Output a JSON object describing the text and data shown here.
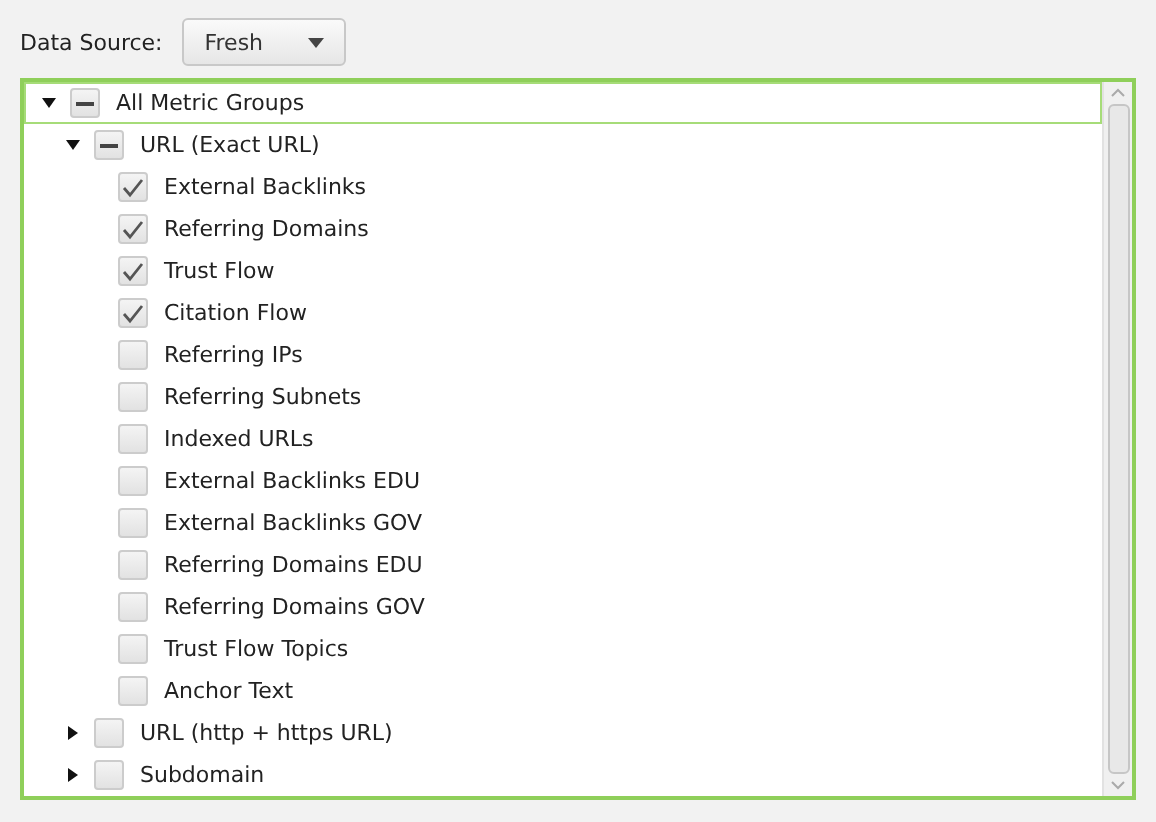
{
  "data_source": {
    "label": "Data Source:",
    "value": "Fresh"
  },
  "tree": [
    {
      "label": "All Metric Groups",
      "partial": true,
      "expanded": true,
      "selected": true,
      "children": [
        {
          "label": "URL (Exact URL)",
          "partial": true,
          "expanded": true,
          "selected": false,
          "children": [
            {
              "label": "External Backlinks",
              "checked": true,
              "partial": false,
              "selected": false
            },
            {
              "label": "Referring Domains",
              "checked": true,
              "partial": false,
              "selected": false
            },
            {
              "label": "Trust Flow",
              "checked": true,
              "partial": false,
              "selected": false
            },
            {
              "label": "Citation Flow",
              "checked": true,
              "partial": false,
              "selected": false
            },
            {
              "label": "Referring IPs",
              "checked": false,
              "partial": false,
              "selected": false
            },
            {
              "label": "Referring Subnets",
              "checked": false,
              "partial": false,
              "selected": false
            },
            {
              "label": "Indexed URLs",
              "checked": false,
              "partial": false,
              "selected": false
            },
            {
              "label": "External Backlinks EDU",
              "checked": false,
              "partial": false,
              "selected": false
            },
            {
              "label": "External Backlinks GOV",
              "checked": false,
              "partial": false,
              "selected": false
            },
            {
              "label": "Referring Domains EDU",
              "checked": false,
              "partial": false,
              "selected": false
            },
            {
              "label": "Referring Domains GOV",
              "checked": false,
              "partial": false,
              "selected": false
            },
            {
              "label": "Trust Flow Topics",
              "checked": false,
              "partial": false,
              "selected": false
            },
            {
              "label": "Anchor Text",
              "checked": false,
              "partial": false,
              "selected": false
            }
          ]
        },
        {
          "label": "URL (http + https URL)",
          "checked": false,
          "partial": false,
          "expanded": false,
          "selected": false
        },
        {
          "label": "Subdomain",
          "checked": false,
          "partial": false,
          "expanded": false,
          "selected": false
        }
      ]
    }
  ]
}
